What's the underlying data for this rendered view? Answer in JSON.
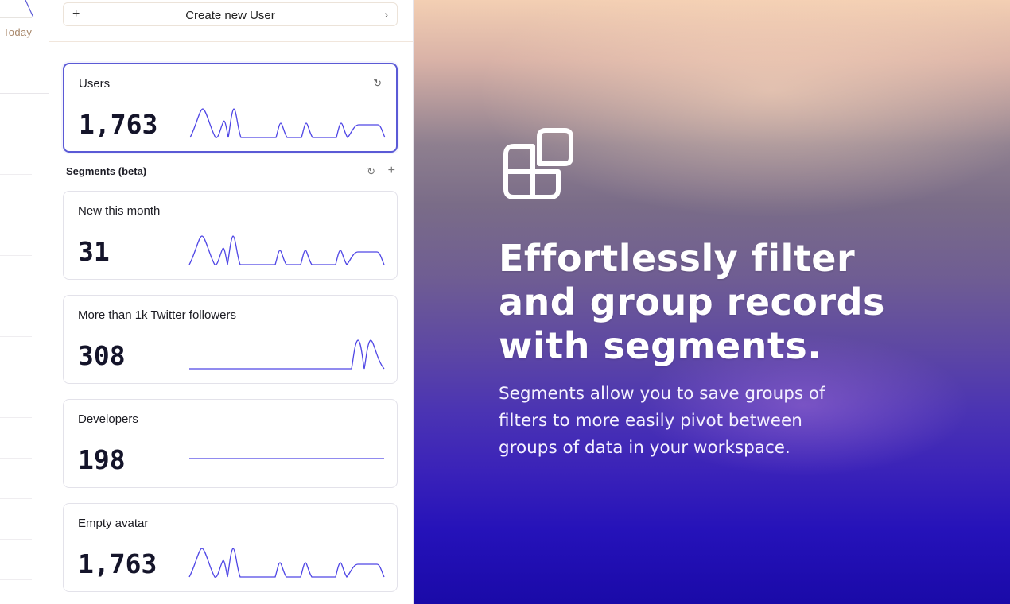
{
  "left_panel": {
    "date_label": "Today"
  },
  "actions": {
    "create_user_label": "Create new User",
    "plus_icon": "plus-icon",
    "chevron_icon": "chevron-right-icon"
  },
  "primary_card": {
    "title": "Users",
    "value": "1,763",
    "refresh_icon": "refresh-icon",
    "sparkline_color": "#4f46e5"
  },
  "segments": {
    "header": "Segments (beta)",
    "refresh_icon": "refresh-icon",
    "add_icon": "plus-icon",
    "items": [
      {
        "title": "New this month",
        "value": "31",
        "trend": "wave"
      },
      {
        "title": "More than 1k Twitter followers",
        "value": "308",
        "trend": "late"
      },
      {
        "title": "Developers",
        "value": "198",
        "trend": "flat"
      },
      {
        "title": "Empty avatar",
        "value": "1,763",
        "trend": "wave"
      }
    ]
  },
  "hero": {
    "logo_icon": "segments-icon",
    "headline": "Effortlessly filter and group records with segments.",
    "body": "Segments allow you to save groups of filters to more easily pivot between groups of data in your workspace.",
    "accent_color": "#2514b8"
  },
  "colors": {
    "active_border": "#5b5ad6",
    "sparkline": "#4f46e5"
  }
}
